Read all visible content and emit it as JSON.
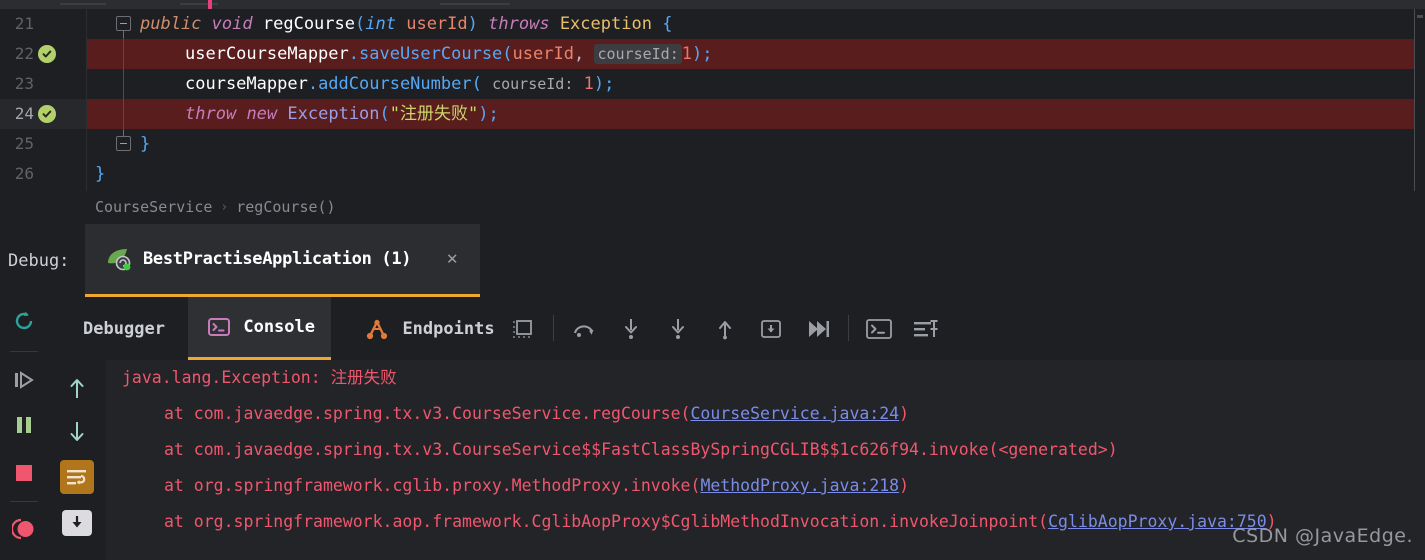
{
  "editor": {
    "lines": [
      {
        "num": "21",
        "marker": null,
        "fold": "open",
        "highlight": false,
        "indent": 0
      },
      {
        "num": "22",
        "marker": "check",
        "fold": null,
        "highlight": true,
        "indent": 1
      },
      {
        "num": "23",
        "marker": null,
        "fold": null,
        "highlight": false,
        "indent": 1
      },
      {
        "num": "24",
        "marker": "check",
        "fold": null,
        "highlight": true,
        "indent": 1,
        "current": true
      },
      {
        "num": "25",
        "marker": null,
        "fold": "close",
        "highlight": false,
        "indent": 0
      },
      {
        "num": "26",
        "marker": null,
        "fold": null,
        "highlight": false,
        "indent": 0
      }
    ],
    "code": {
      "l21": {
        "kw_public": "public",
        "kw_void": "void",
        "method": "regCourse",
        "paren_open": "(",
        "type_int": "int",
        "param_userid": "userId",
        "paren_close": ")",
        "kw_throws": "throws",
        "cls_exception": "Exception",
        "brace": "{"
      },
      "l22": {
        "receiver": "userCourseMapper",
        "dot_method": ".saveUserCourse",
        "paren_open": "(",
        "arg_userid": "userId",
        "comma": ", ",
        "inlay": "courseId:",
        "num": "1",
        "tail": ");"
      },
      "l23": {
        "receiver": "courseMapper",
        "dot_method": ".addCourseNumber",
        "paren_open": "( ",
        "inlay": "courseId:",
        "num": "1",
        "tail": ");"
      },
      "l24": {
        "kw_throw": "throw",
        "kw_new": "new",
        "cls_exception": "Exception",
        "paren_open": "(",
        "string": "\"注册失败\"",
        "tail": ");"
      },
      "l25": {
        "brace": "}"
      },
      "l26": {
        "brace": "}"
      }
    }
  },
  "breadcrumb": {
    "class": "CourseService",
    "separator": "›",
    "method": "regCourse()"
  },
  "debug_header": {
    "label": "Debug:",
    "run_tab": "BestPractiseApplication (1)",
    "close": "×"
  },
  "tabs": [
    {
      "label": "Debugger",
      "icon": null,
      "active": false
    },
    {
      "label": "Console",
      "icon": "console-icon",
      "active": true
    },
    {
      "label": "Endpoints",
      "icon": "endpoints-icon",
      "active": false
    }
  ],
  "toolbar_icons": [
    {
      "name": "show-execution-point-icon"
    },
    {
      "name": "step-over-icon"
    },
    {
      "name": "step-into-icon"
    },
    {
      "name": "force-step-into-icon"
    },
    {
      "name": "step-out-icon"
    },
    {
      "name": "drop-frame-icon"
    },
    {
      "name": "run-to-cursor-icon"
    },
    {
      "name": "evaluate-expression-icon"
    },
    {
      "name": "debug-settings-icon"
    }
  ],
  "side_rail_icons": [
    {
      "name": "rerun-icon"
    },
    {
      "name": "resume-program-icon"
    },
    {
      "name": "pause-program-icon"
    },
    {
      "name": "stop-program-icon"
    },
    {
      "name": "view-breakpoints-icon"
    }
  ],
  "console_rail_icons": [
    {
      "name": "scroll-up-icon"
    },
    {
      "name": "scroll-down-icon"
    },
    {
      "name": "soft-wrap-icon",
      "active": true
    },
    {
      "name": "scroll-to-end-icon"
    }
  ],
  "console_output": {
    "line1_prefix": "java.lang.Exception: ",
    "line1_message": "注册失败",
    "line2_text": "at com.javaedge.spring.tx.v3.CourseService.regCourse(",
    "line2_link": "CourseService.java:24",
    "line2_tail": ")",
    "line3_text": "at com.javaedge.spring.tx.v3.CourseService$$FastClassBySpringCGLIB$$1c626f94.invoke(<generated>)",
    "line4_text": "at org.springframework.cglib.proxy.MethodProxy.invoke(",
    "line4_link": "MethodProxy.java:218",
    "line4_tail": ")",
    "line5_text": "at org.springframework.aop.framework.CglibAopProxy$CglibMethodInvocation.invokeJoinpoint(",
    "line5_link": "CglibAopProxy.java:750",
    "line5_tail": ")"
  },
  "watermark": "CSDN @JavaEdge.",
  "colors": {
    "editor_bg": "#1e1f22",
    "console_bg": "#232427",
    "panel_bg": "#2b2d30",
    "error_red": "#f0576e",
    "highlight_red": "#5a1d1d",
    "accent_orange": "#f0a732",
    "link_blue": "#7b8ce8"
  }
}
